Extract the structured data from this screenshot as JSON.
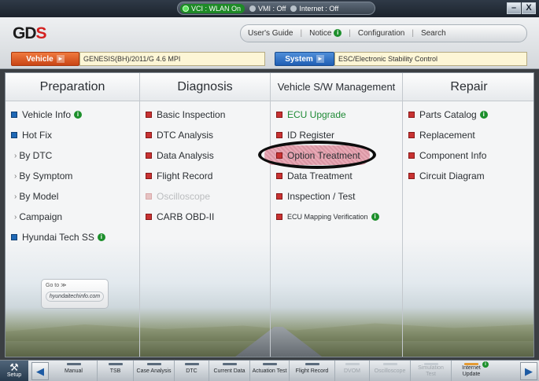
{
  "titlebar": {
    "status": {
      "vci": "VCI : WLAN On",
      "vmi": "VMI : Off",
      "internet": "Internet : Off"
    },
    "minimize_glyph": "–",
    "close_glyph": "X"
  },
  "header": {
    "logo_main": "GD",
    "logo_accent": "S",
    "nav": {
      "users_guide": "User's Guide",
      "notice": "Notice",
      "notice_badge": "i",
      "configuration": "Configuration",
      "search": "Search"
    },
    "vehicle_label": "Vehicle",
    "vehicle_value": "GENESIS(BH)/2011/G 4.6 MPI",
    "system_label": "System",
    "system_value": "ESC/Electronic Stability Control",
    "arrow_glyph": "▸"
  },
  "columns": [
    {
      "title": "Preparation",
      "items": [
        {
          "label": "Vehicle Info",
          "badge": "i"
        },
        {
          "label": "Hot Fix"
        },
        {
          "label": "By DTC"
        },
        {
          "label": "By Symptom"
        },
        {
          "label": "By Model"
        },
        {
          "label": "Campaign"
        },
        {
          "label": "Hyundai Tech SS",
          "badge": "i"
        }
      ],
      "goto": {
        "caption": "Go to ≫",
        "url": "hyundaitechinfo.com"
      }
    },
    {
      "title": "Diagnosis",
      "items": [
        {
          "label": "Basic Inspection"
        },
        {
          "label": "DTC Analysis"
        },
        {
          "label": "Data Analysis"
        },
        {
          "label": "Flight Record"
        },
        {
          "label": "Oscilloscope"
        },
        {
          "label": "CARB OBD-II"
        }
      ]
    },
    {
      "title": "Vehicle S/W Management",
      "items": [
        {
          "label": "ECU Upgrade"
        },
        {
          "label": "ID Register"
        },
        {
          "label": "Option Treatment"
        },
        {
          "label": "Data Treatment"
        },
        {
          "label": "Inspection / Test"
        },
        {
          "label": "ECU Mapping Verification",
          "badge": "i"
        }
      ]
    },
    {
      "title": "Repair",
      "items": [
        {
          "label": "Parts Catalog",
          "badge": "i"
        },
        {
          "label": "Replacement"
        },
        {
          "label": "Component Info"
        },
        {
          "label": "Circuit Diagram"
        }
      ]
    }
  ],
  "toolbar": {
    "setup_label": "Setup",
    "setup_icon": "⚒",
    "prev_glyph": "◀",
    "next_glyph": "▶",
    "tools": [
      {
        "label": "Manual"
      },
      {
        "label": "TSB"
      },
      {
        "label": "Case Analysis"
      },
      {
        "label": "DTC"
      },
      {
        "label": "Current Data"
      },
      {
        "label": "Actuation Test"
      },
      {
        "label": "Flight Record"
      },
      {
        "label": "DVOM"
      },
      {
        "label": "Oscilloscope"
      },
      {
        "label": "Simulation Test"
      },
      {
        "label": "Internet Update",
        "badge": "i"
      }
    ]
  },
  "colors": {
    "vehicle_orange": "#e0622a",
    "system_blue": "#2f73c9",
    "highlight_pink": "#e0a0ae",
    "badge_green": "#1c8f2b"
  }
}
